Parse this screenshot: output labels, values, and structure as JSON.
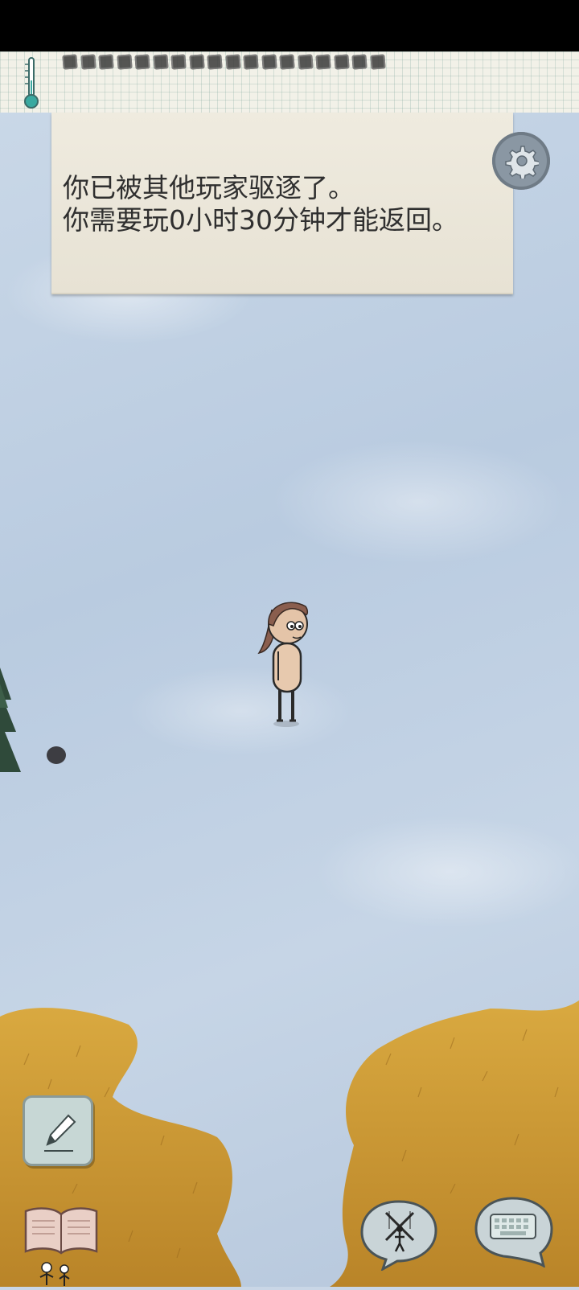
{
  "notice": {
    "lines": [
      "你已被其他玩家驱逐了。",
      "你需要玩0小时30分钟才能返回。"
    ]
  },
  "hud": {
    "food_pips": 18
  },
  "colors": {
    "snow": "#c6d5e6",
    "grass": "#c9962f",
    "note_paper": "#ece8dc",
    "button_teal": "#c7d7d5"
  },
  "icons": {
    "thermometer": "thermometer-icon",
    "settings": "gear-icon",
    "pencil": "pencil-icon",
    "book": "book-icon",
    "puppet": "puppet-icon",
    "keyboard": "keyboard-icon"
  }
}
